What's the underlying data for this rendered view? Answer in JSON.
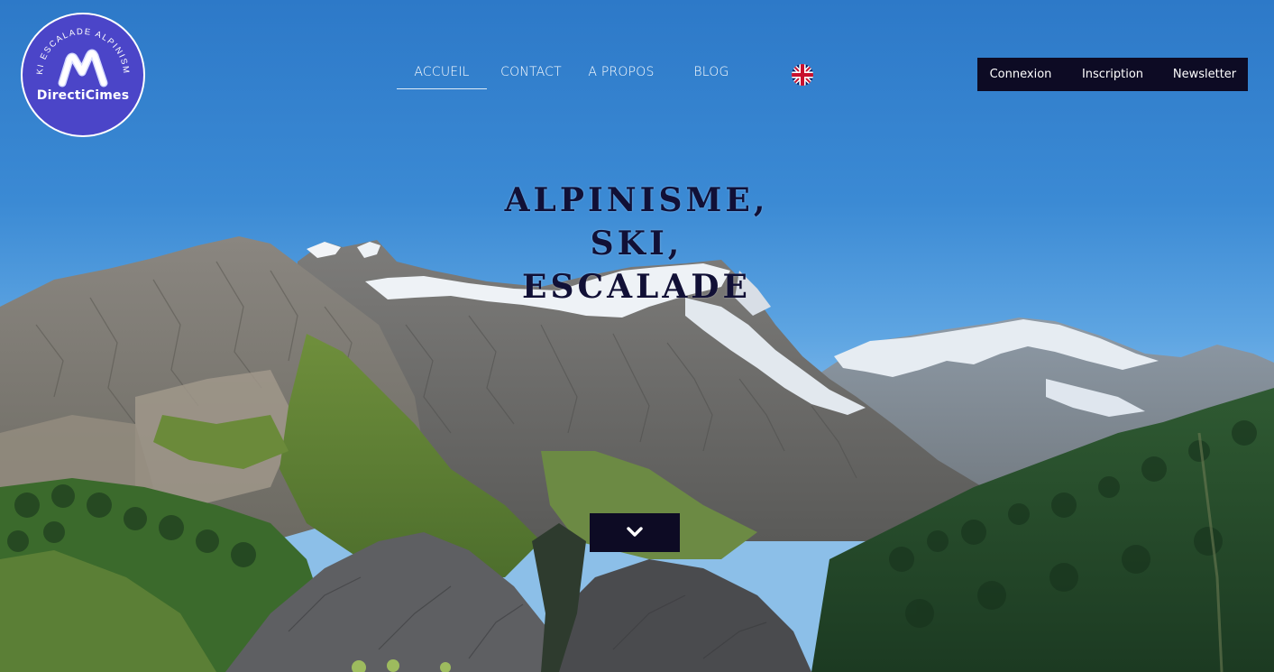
{
  "brand": {
    "logo_name": "DirectiCimes",
    "logo_ring_text": "SKI ESCALADE ALPINISME",
    "color": "#4b45c8"
  },
  "nav": {
    "items": [
      {
        "label": "ACCUEIL",
        "active": true
      },
      {
        "label": "CONTACT",
        "active": false
      },
      {
        "label": "A PROPOS",
        "active": false
      },
      {
        "label": "BLOG",
        "active": false
      }
    ],
    "language_icon": "uk-flag-icon"
  },
  "account": {
    "login_label": "Connexion",
    "signup_label": "Inscription",
    "newsletter_label": "Newsletter",
    "background": "#0d0b24"
  },
  "hero": {
    "title_line1": "ALPINISME, SKI,",
    "title_line2": "ESCALADE",
    "scroll_icon": "chevron-down-icon"
  }
}
